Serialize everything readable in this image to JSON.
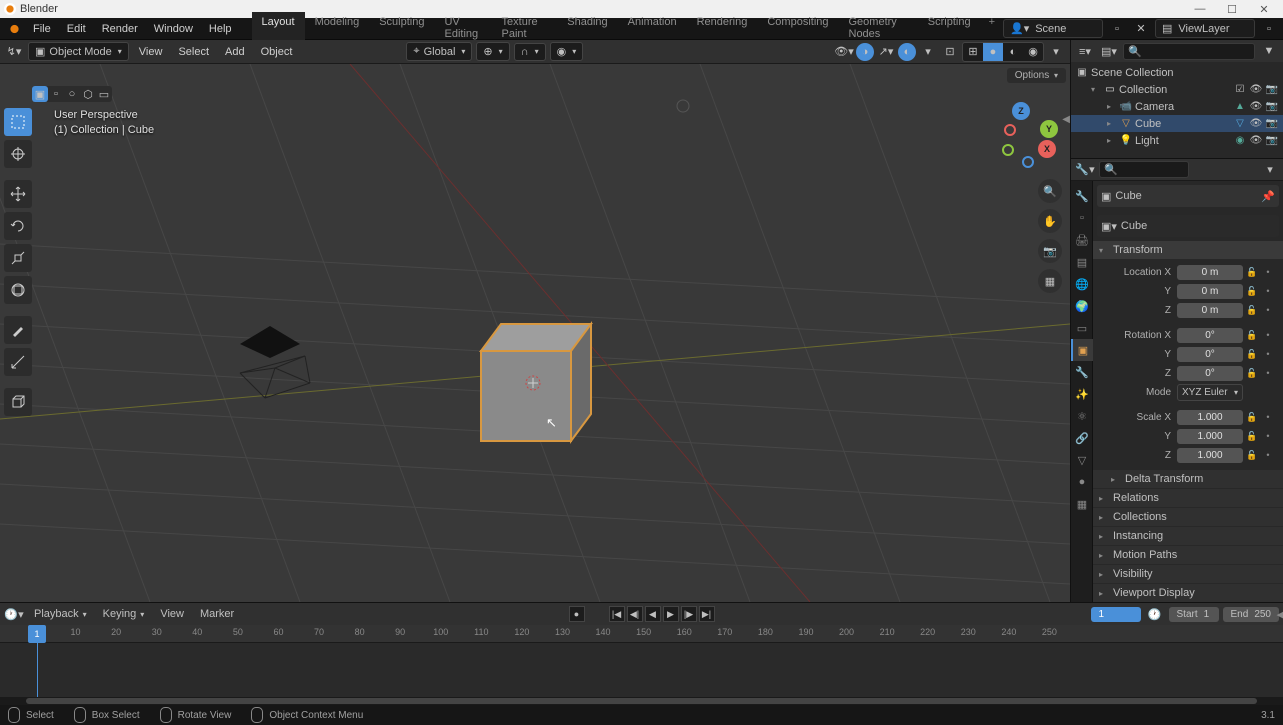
{
  "app": {
    "title": "Blender"
  },
  "menu": [
    "File",
    "Edit",
    "Render",
    "Window",
    "Help"
  ],
  "workspaces": [
    "Layout",
    "Modeling",
    "Sculpting",
    "UV Editing",
    "Texture Paint",
    "Shading",
    "Animation",
    "Rendering",
    "Compositing",
    "Geometry Nodes",
    "Scripting"
  ],
  "active_workspace": 0,
  "scene": {
    "name": "Scene",
    "layer": "ViewLayer"
  },
  "viewport_header": {
    "mode": "Object Mode",
    "menus": [
      "View",
      "Select",
      "Add",
      "Object"
    ],
    "orientation": "Global",
    "options_label": "Options"
  },
  "overlay": {
    "perspective": "User Perspective",
    "context": "(1) Collection | Cube"
  },
  "outliner": {
    "root": "Scene Collection",
    "collection": "Collection",
    "items": [
      {
        "name": "Camera",
        "icon": "camera"
      },
      {
        "name": "Cube",
        "icon": "mesh",
        "selected": true
      },
      {
        "name": "Light",
        "icon": "light"
      }
    ]
  },
  "properties": {
    "breadcrumb1": "Cube",
    "breadcrumb2": "Cube",
    "panel_transform": "Transform",
    "loc_label": "Location X",
    "rot_label": "Rotation X",
    "scale_label": "Scale X",
    "mode_label": "Mode",
    "axis_y": "Y",
    "axis_z": "Z",
    "loc": {
      "x": "0 m",
      "y": "0 m",
      "z": "0 m"
    },
    "rot": {
      "x": "0°",
      "y": "0°",
      "z": "0°"
    },
    "rot_mode": "XYZ Euler",
    "scale": {
      "x": "1.000",
      "y": "1.000",
      "z": "1.000"
    },
    "sub_panels": [
      "Delta Transform",
      "Relations",
      "Collections",
      "Instancing",
      "Motion Paths",
      "Visibility",
      "Viewport Display"
    ]
  },
  "timeline": {
    "menus": [
      "Playback",
      "Keying",
      "View",
      "Marker"
    ],
    "current": "1",
    "start_label": "Start",
    "start": "1",
    "end_label": "End",
    "end": "250",
    "ticks": [
      "10",
      "20",
      "30",
      "40",
      "50",
      "60",
      "70",
      "80",
      "90",
      "100",
      "110",
      "120",
      "130",
      "140",
      "150",
      "160",
      "170",
      "180",
      "190",
      "200",
      "210",
      "220",
      "230",
      "240",
      "250"
    ]
  },
  "status": {
    "select": "Select",
    "box_select": "Box Select",
    "rotate": "Rotate View",
    "menu": "Object Context Menu",
    "version": "3.1"
  }
}
